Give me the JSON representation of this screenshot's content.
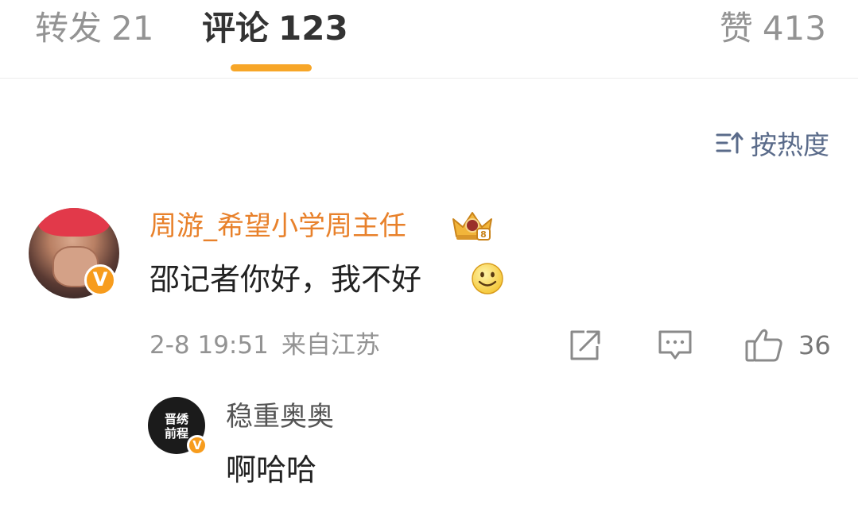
{
  "tabs": {
    "reposts": {
      "label": "转发",
      "count": "21"
    },
    "comments": {
      "label": "评论",
      "count": "123",
      "active": true
    },
    "likes": {
      "label": "赞",
      "count": "413"
    }
  },
  "sort": {
    "label": "按热度"
  },
  "comment": {
    "username": "周游_希望小学周主任",
    "text": "邵记者你好，我不好",
    "date": "2-8 19:51",
    "location": "来自江苏",
    "like_count": "36",
    "verified_badge": "V"
  },
  "reply": {
    "username": "稳重奥奥",
    "text": "啊哈哈",
    "verified_badge": "V",
    "avatar_text_line1": "晋绣",
    "avatar_text_line2": "前程"
  },
  "colors": {
    "accent": "#f7a628",
    "username": "#e8812b",
    "link_blue": "#5a6b8a",
    "muted": "#939393"
  },
  "icons": {
    "sort": "sort-icon",
    "crown": "crown-icon",
    "smile": "smile-emoji-icon",
    "share": "share-icon",
    "reply": "comment-icon",
    "like": "thumbs-up-icon"
  }
}
